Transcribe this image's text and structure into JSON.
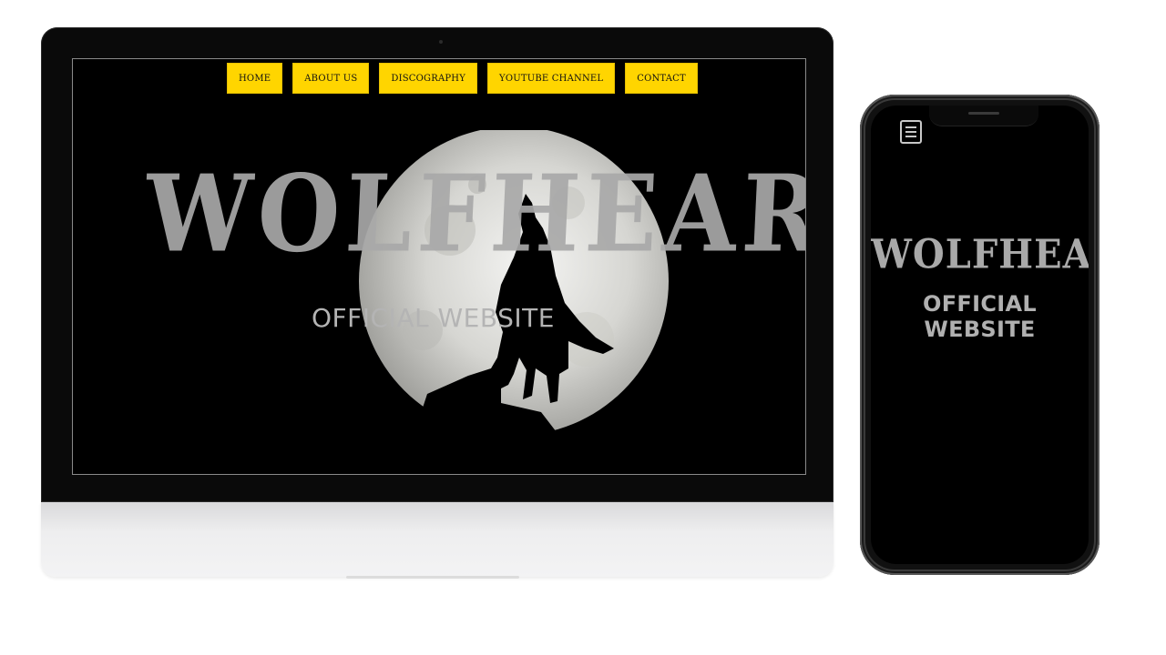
{
  "desktop": {
    "nav": {
      "items": [
        {
          "label": "HOME"
        },
        {
          "label": "ABOUT US"
        },
        {
          "label": "DISCOGRAPHY"
        },
        {
          "label": "YOUTUBE CHANNEL"
        },
        {
          "label": "CONTACT"
        }
      ]
    },
    "hero": {
      "title": "WOLFHEART",
      "subtitle": "OFFICIAL WEBSITE",
      "image_icon": "moon-wolf-icon"
    }
  },
  "mobile": {
    "menu_icon": "menu-icon",
    "title": "WOLFHEART",
    "subtitle": "OFFICIAL WEBSITE"
  },
  "colors": {
    "nav_button_bg": "#ffd500",
    "page_bg": "#000000",
    "title_text": "#a9a9a9"
  }
}
